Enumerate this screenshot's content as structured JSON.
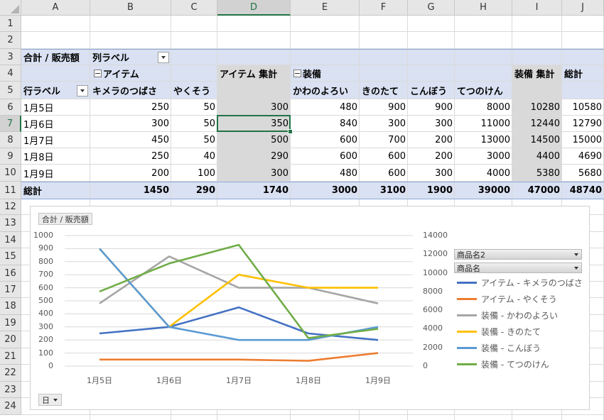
{
  "columns": [
    "A",
    "B",
    "C",
    "D",
    "E",
    "F",
    "G",
    "H",
    "I",
    "J"
  ],
  "rows": [
    "1",
    "2",
    "3",
    "4",
    "5",
    "6",
    "7",
    "8",
    "9",
    "10",
    "11",
    "12",
    "13",
    "14",
    "15",
    "16",
    "17",
    "18",
    "19",
    "20",
    "21",
    "22",
    "23",
    "24"
  ],
  "pivot": {
    "values_label": "合計 / 販売額",
    "col_labels": "列ラベル",
    "row_labels": "行ラベル",
    "group_item": "アイテム",
    "group_item_total": "アイテム 集計",
    "group_equip": "装備",
    "group_equip_total": "装備 集計",
    "grand_total": "総計",
    "headers": [
      "キメラのつばさ",
      "やくそう",
      "かわのよろい",
      "きのたて",
      "こんぼう",
      "てつのけん"
    ],
    "data": [
      [
        "1月5日",
        "250",
        "50",
        "300",
        "480",
        "900",
        "900",
        "8000",
        "10280",
        "10580"
      ],
      [
        "1月6日",
        "300",
        "50",
        "350",
        "840",
        "300",
        "300",
        "11000",
        "12440",
        "12790"
      ],
      [
        "1月7日",
        "450",
        "50",
        "500",
        "600",
        "700",
        "200",
        "13000",
        "14500",
        "15000"
      ],
      [
        "1月8日",
        "250",
        "40",
        "290",
        "600",
        "600",
        "200",
        "3000",
        "4400",
        "4690"
      ],
      [
        "1月9日",
        "200",
        "100",
        "300",
        "480",
        "600",
        "300",
        "4000",
        "5380",
        "5680"
      ]
    ],
    "totals": [
      "総計",
      "1450",
      "290",
      "1740",
      "3000",
      "3100",
      "1900",
      "39000",
      "47000",
      "48740"
    ]
  },
  "chart": {
    "field_values": "合計 / 販売額",
    "field_axis": "日",
    "legend_field1": "商品名2",
    "legend_field2": "商品名"
  },
  "chart_data": {
    "type": "line",
    "categories": [
      "1月5日",
      "1月6日",
      "1月7日",
      "1月8日",
      "1月9日"
    ],
    "primary_ylim": [
      0,
      1000
    ],
    "primary_ticks": [
      "0",
      "100",
      "200",
      "300",
      "400",
      "500",
      "600",
      "700",
      "800",
      "900",
      "1000"
    ],
    "secondary_ylim": [
      0,
      14000
    ],
    "secondary_ticks": [
      "0",
      "2000",
      "4000",
      "6000",
      "8000",
      "10000",
      "12000",
      "14000"
    ],
    "series": [
      {
        "name": "アイテム - キメラのつばさ",
        "color": "#4472C4",
        "axis": "primary",
        "values": [
          250,
          300,
          450,
          250,
          200
        ]
      },
      {
        "name": "アイテム - やくそう",
        "color": "#ED7D31",
        "axis": "primary",
        "values": [
          50,
          50,
          50,
          40,
          100
        ]
      },
      {
        "name": "装備 - かわのよろい",
        "color": "#A5A5A5",
        "axis": "primary",
        "values": [
          480,
          840,
          600,
          600,
          480
        ]
      },
      {
        "name": "装備 - きのたて",
        "color": "#FFC000",
        "axis": "primary",
        "values": [
          900,
          300,
          700,
          600,
          600
        ]
      },
      {
        "name": "装備 - こんぼう",
        "color": "#5B9BD5",
        "axis": "primary",
        "values": [
          900,
          300,
          200,
          200,
          300
        ]
      },
      {
        "name": "装備 - てつのけん",
        "color": "#70AD47",
        "axis": "secondary",
        "values": [
          8000,
          11000,
          13000,
          3000,
          4000
        ]
      }
    ]
  }
}
